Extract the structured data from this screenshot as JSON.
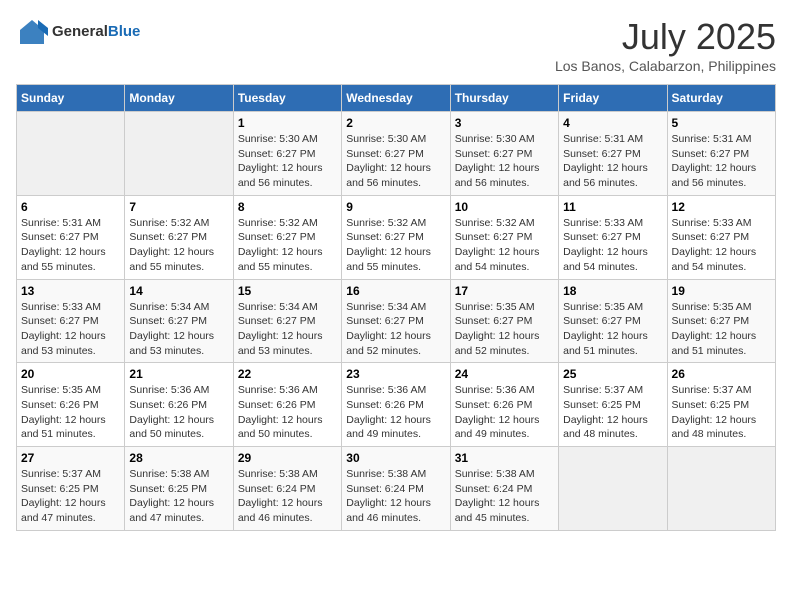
{
  "header": {
    "logo_general": "General",
    "logo_blue": "Blue",
    "month_title": "July 2025",
    "location": "Los Banos, Calabarzon, Philippines"
  },
  "days_of_week": [
    "Sunday",
    "Monday",
    "Tuesday",
    "Wednesday",
    "Thursday",
    "Friday",
    "Saturday"
  ],
  "weeks": [
    [
      {
        "day": "",
        "info": ""
      },
      {
        "day": "",
        "info": ""
      },
      {
        "day": "1",
        "info": "Sunrise: 5:30 AM\nSunset: 6:27 PM\nDaylight: 12 hours and 56 minutes."
      },
      {
        "day": "2",
        "info": "Sunrise: 5:30 AM\nSunset: 6:27 PM\nDaylight: 12 hours and 56 minutes."
      },
      {
        "day": "3",
        "info": "Sunrise: 5:30 AM\nSunset: 6:27 PM\nDaylight: 12 hours and 56 minutes."
      },
      {
        "day": "4",
        "info": "Sunrise: 5:31 AM\nSunset: 6:27 PM\nDaylight: 12 hours and 56 minutes."
      },
      {
        "day": "5",
        "info": "Sunrise: 5:31 AM\nSunset: 6:27 PM\nDaylight: 12 hours and 56 minutes."
      }
    ],
    [
      {
        "day": "6",
        "info": "Sunrise: 5:31 AM\nSunset: 6:27 PM\nDaylight: 12 hours and 55 minutes."
      },
      {
        "day": "7",
        "info": "Sunrise: 5:32 AM\nSunset: 6:27 PM\nDaylight: 12 hours and 55 minutes."
      },
      {
        "day": "8",
        "info": "Sunrise: 5:32 AM\nSunset: 6:27 PM\nDaylight: 12 hours and 55 minutes."
      },
      {
        "day": "9",
        "info": "Sunrise: 5:32 AM\nSunset: 6:27 PM\nDaylight: 12 hours and 55 minutes."
      },
      {
        "day": "10",
        "info": "Sunrise: 5:32 AM\nSunset: 6:27 PM\nDaylight: 12 hours and 54 minutes."
      },
      {
        "day": "11",
        "info": "Sunrise: 5:33 AM\nSunset: 6:27 PM\nDaylight: 12 hours and 54 minutes."
      },
      {
        "day": "12",
        "info": "Sunrise: 5:33 AM\nSunset: 6:27 PM\nDaylight: 12 hours and 54 minutes."
      }
    ],
    [
      {
        "day": "13",
        "info": "Sunrise: 5:33 AM\nSunset: 6:27 PM\nDaylight: 12 hours and 53 minutes."
      },
      {
        "day": "14",
        "info": "Sunrise: 5:34 AM\nSunset: 6:27 PM\nDaylight: 12 hours and 53 minutes."
      },
      {
        "day": "15",
        "info": "Sunrise: 5:34 AM\nSunset: 6:27 PM\nDaylight: 12 hours and 53 minutes."
      },
      {
        "day": "16",
        "info": "Sunrise: 5:34 AM\nSunset: 6:27 PM\nDaylight: 12 hours and 52 minutes."
      },
      {
        "day": "17",
        "info": "Sunrise: 5:35 AM\nSunset: 6:27 PM\nDaylight: 12 hours and 52 minutes."
      },
      {
        "day": "18",
        "info": "Sunrise: 5:35 AM\nSunset: 6:27 PM\nDaylight: 12 hours and 51 minutes."
      },
      {
        "day": "19",
        "info": "Sunrise: 5:35 AM\nSunset: 6:27 PM\nDaylight: 12 hours and 51 minutes."
      }
    ],
    [
      {
        "day": "20",
        "info": "Sunrise: 5:35 AM\nSunset: 6:26 PM\nDaylight: 12 hours and 51 minutes."
      },
      {
        "day": "21",
        "info": "Sunrise: 5:36 AM\nSunset: 6:26 PM\nDaylight: 12 hours and 50 minutes."
      },
      {
        "day": "22",
        "info": "Sunrise: 5:36 AM\nSunset: 6:26 PM\nDaylight: 12 hours and 50 minutes."
      },
      {
        "day": "23",
        "info": "Sunrise: 5:36 AM\nSunset: 6:26 PM\nDaylight: 12 hours and 49 minutes."
      },
      {
        "day": "24",
        "info": "Sunrise: 5:36 AM\nSunset: 6:26 PM\nDaylight: 12 hours and 49 minutes."
      },
      {
        "day": "25",
        "info": "Sunrise: 5:37 AM\nSunset: 6:25 PM\nDaylight: 12 hours and 48 minutes."
      },
      {
        "day": "26",
        "info": "Sunrise: 5:37 AM\nSunset: 6:25 PM\nDaylight: 12 hours and 48 minutes."
      }
    ],
    [
      {
        "day": "27",
        "info": "Sunrise: 5:37 AM\nSunset: 6:25 PM\nDaylight: 12 hours and 47 minutes."
      },
      {
        "day": "28",
        "info": "Sunrise: 5:38 AM\nSunset: 6:25 PM\nDaylight: 12 hours and 47 minutes."
      },
      {
        "day": "29",
        "info": "Sunrise: 5:38 AM\nSunset: 6:24 PM\nDaylight: 12 hours and 46 minutes."
      },
      {
        "day": "30",
        "info": "Sunrise: 5:38 AM\nSunset: 6:24 PM\nDaylight: 12 hours and 46 minutes."
      },
      {
        "day": "31",
        "info": "Sunrise: 5:38 AM\nSunset: 6:24 PM\nDaylight: 12 hours and 45 minutes."
      },
      {
        "day": "",
        "info": ""
      },
      {
        "day": "",
        "info": ""
      }
    ]
  ]
}
